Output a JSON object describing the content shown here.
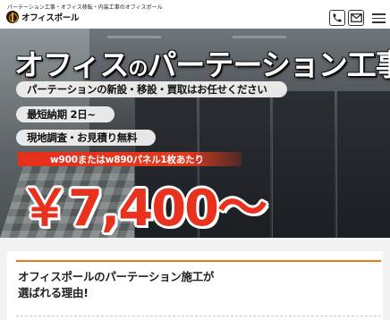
{
  "header": {
    "tagline": "パーテーション工事・オフィス移転・内装工事のオフィスポール",
    "logo_text": "オフィスポール"
  },
  "hero": {
    "title_part1": "オフィス",
    "title_no": "の",
    "title_part2": "パーテーション工事",
    "badges": [
      "パーテーションの新設・移設・買取はお任せください",
      "最短納期 2日~",
      "現地調査・お見積り無料"
    ],
    "panel_note": "w900またはw890パネル1枚あたり",
    "price": "￥7,400～"
  },
  "section": {
    "title_line1": "オフィスポールのパーテーション施工が",
    "title_line2": "選ばれる理由!"
  },
  "colors": {
    "accent_red": "#e8321e",
    "accent_orange": "#f07a1a"
  },
  "icons": [
    "phone-icon",
    "mail-icon",
    "hamburger-menu-icon",
    "logo-icon"
  ]
}
